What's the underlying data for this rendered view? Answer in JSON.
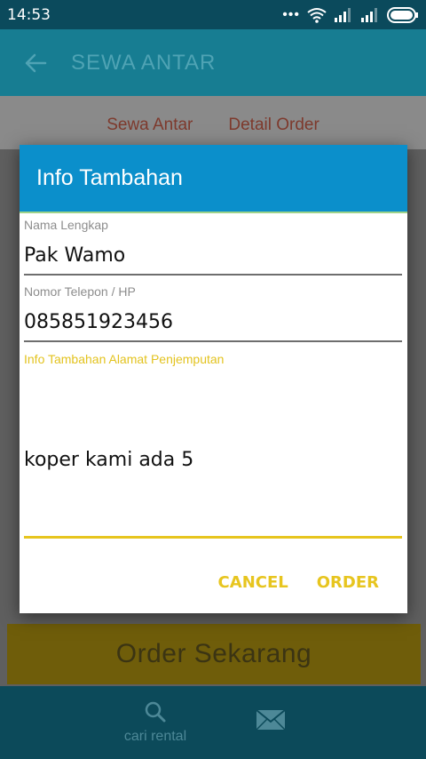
{
  "status_bar": {
    "time": "14:53"
  },
  "app_bar": {
    "title": "SEWA ANTAR"
  },
  "tabs": [
    {
      "label": "Sewa Antar"
    },
    {
      "label": "Detail Order"
    }
  ],
  "dialog": {
    "title": "Info Tambahan",
    "fields": [
      {
        "label": "Nama Lengkap",
        "value": "Pak Wamo"
      },
      {
        "label": "Nomor Telepon / HP",
        "value": "085851923456"
      }
    ],
    "textarea": {
      "label": "Info Tambahan Alamat Penjemputan",
      "value": "koper kami ada 5"
    },
    "cancel_label": "CANCEL",
    "order_label": "ORDER"
  },
  "order_button": {
    "label": "Order Sekarang"
  },
  "bottom_nav": {
    "items": [
      {
        "label": "cari rental",
        "icon": "search-icon"
      },
      {
        "label": "",
        "icon": "mail-icon"
      }
    ]
  },
  "colors": {
    "dialog_header": "#0b8fcb",
    "accent": "#e7c51f",
    "app_bar": "#177d92"
  }
}
